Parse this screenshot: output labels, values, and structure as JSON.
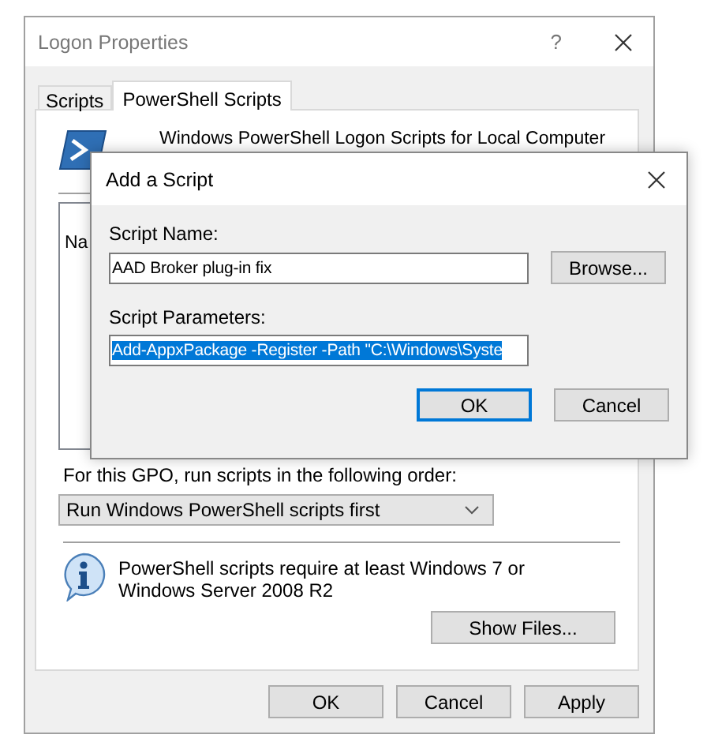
{
  "window": {
    "title": "Logon Properties",
    "help_button": "?"
  },
  "tabs": [
    {
      "label": "Scripts",
      "selected": false
    },
    {
      "label": "PowerShell Scripts",
      "selected": true
    }
  ],
  "panel": {
    "heading": "Windows PowerShell Logon Scripts for Local Computer",
    "list": {
      "columns": [
        "Na"
      ]
    },
    "order_label": "For this GPO, run scripts in the following order:",
    "order_dropdown": {
      "value": "Run Windows PowerShell scripts first"
    },
    "info": "PowerShell scripts require at least Windows 7 or Windows Server 2008 R2",
    "show_files_button": "Show Files..."
  },
  "buttons": [
    {
      "label": "OK"
    },
    {
      "label": "Cancel"
    },
    {
      "label": "Apply"
    }
  ],
  "dialog": {
    "title": "Add a Script",
    "fields": [
      {
        "label": "Script Name:",
        "value": "AAD Broker plug-in fix",
        "text_selected": false
      },
      {
        "label": "Script Parameters:",
        "value": "Add-AppxPackage -Register -Path \"C:\\Windows\\Syste",
        "text_selected": true
      }
    ],
    "browse_button": "Browse...",
    "buttons": [
      {
        "label": "OK",
        "default": true
      },
      {
        "label": "Cancel",
        "default": false
      }
    ]
  }
}
